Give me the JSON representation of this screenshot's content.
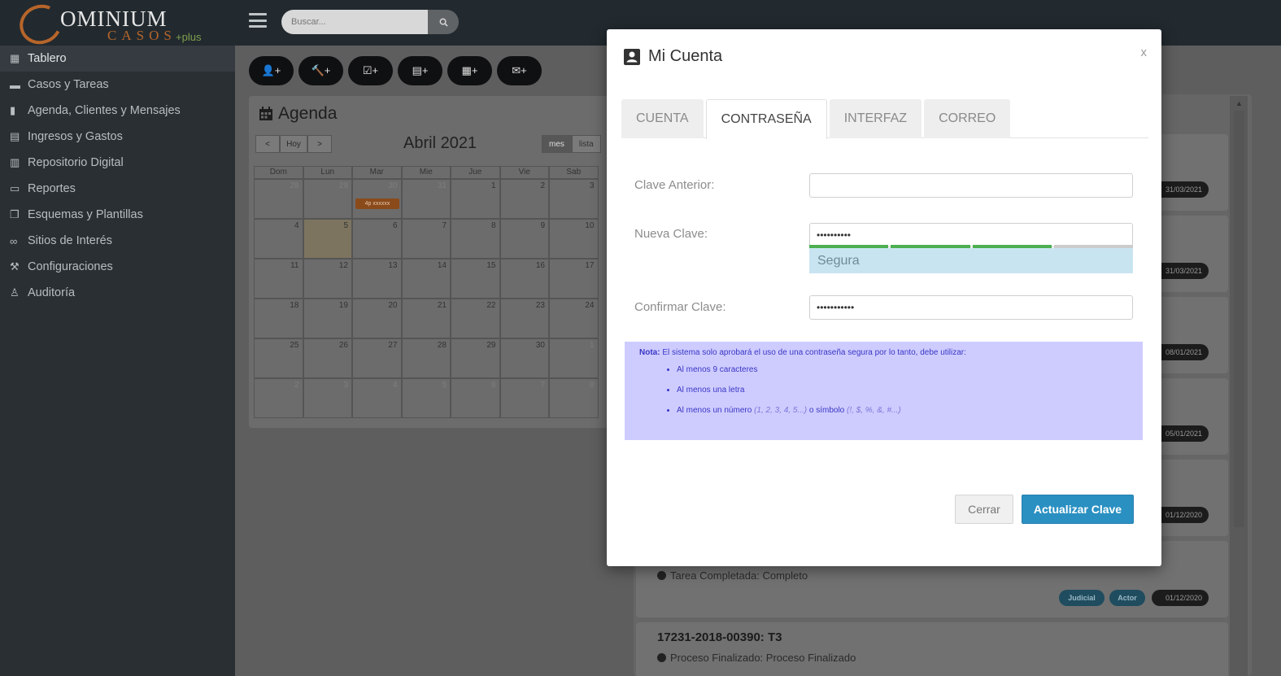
{
  "brand": {
    "main": "OMINIUM",
    "sub": "CASOS",
    "plus": "+plus"
  },
  "search": {
    "placeholder": "Buscar...",
    "button_icon": "search-icon"
  },
  "sidebar": {
    "items": [
      {
        "label": "Tablero",
        "icon": "table-icon",
        "glyph": "▦"
      },
      {
        "label": "Casos y Tareas",
        "icon": "folder-icon",
        "glyph": "▬"
      },
      {
        "label": "Agenda, Clientes y Mensajes",
        "icon": "book-icon",
        "glyph": "▮"
      },
      {
        "label": "Ingresos y Gastos",
        "icon": "file-icon",
        "glyph": "▤"
      },
      {
        "label": "Repositorio Digital",
        "icon": "library-icon",
        "glyph": "▥"
      },
      {
        "label": "Reportes",
        "icon": "report-icon",
        "glyph": "▭"
      },
      {
        "label": "Esquemas y Plantillas",
        "icon": "copy-icon",
        "glyph": "❐"
      },
      {
        "label": "Sitios de Interés",
        "icon": "link-icon",
        "glyph": "∞"
      },
      {
        "label": "Configuraciones",
        "icon": "wrench-icon",
        "glyph": "⚒"
      },
      {
        "label": "Auditoría",
        "icon": "auditor-icon",
        "glyph": "♙"
      }
    ]
  },
  "toolbar": {
    "buttons": [
      {
        "glyph": "👤+",
        "icon": "add-user-icon"
      },
      {
        "glyph": "🔨+",
        "icon": "add-case-icon"
      },
      {
        "glyph": "☑+",
        "icon": "add-task-icon"
      },
      {
        "glyph": "▤+",
        "icon": "add-document-icon"
      },
      {
        "glyph": "▦+",
        "icon": "add-event-icon"
      },
      {
        "glyph": "✉+",
        "icon": "add-message-icon"
      }
    ]
  },
  "agenda": {
    "title": "Agenda",
    "nav": {
      "prev": "<",
      "today": "Hoy",
      "next": ">"
    },
    "month": "Abril 2021",
    "views": {
      "month": "mes",
      "list": "lista"
    },
    "weekdays": [
      "Dom",
      "Lun",
      "Mar",
      "Mie",
      "Jue",
      "Vie",
      "Sab"
    ],
    "weeks": [
      [
        "28",
        "29",
        "30",
        "31",
        "1",
        "2",
        "3"
      ],
      [
        "4",
        "5",
        "6",
        "7",
        "8",
        "9",
        "10"
      ],
      [
        "11",
        "12",
        "13",
        "14",
        "15",
        "16",
        "17"
      ],
      [
        "18",
        "19",
        "20",
        "21",
        "22",
        "23",
        "24"
      ],
      [
        "25",
        "26",
        "27",
        "28",
        "29",
        "30",
        "1"
      ],
      [
        "2",
        "3",
        "4",
        "5",
        "6",
        "7",
        "8"
      ]
    ],
    "event_label": "4p xxxxxx"
  },
  "cases": {
    "dates": [
      "31/03/2021",
      "31/03/2021",
      "08/01/2021",
      "05/01/2021",
      "01/12/2020"
    ],
    "completed_task": {
      "status": "Tarea Completada: Completo",
      "tags": [
        "Judicial",
        "Actor"
      ],
      "date": "01/12/2020"
    },
    "last": {
      "title": "17231-2018-00390: T3",
      "status": "Proceso Finalizado: Proceso Finalizado"
    }
  },
  "modal": {
    "title": "Mi Cuenta",
    "title_icon": "account-card-icon",
    "close": "x",
    "tabs": [
      "CUENTA",
      "CONTRASEÑA",
      "INTERFAZ",
      "CORREO"
    ],
    "active_tab": "CONTRASEÑA",
    "fields": {
      "old_label": "Clave Anterior:",
      "old_value": "",
      "new_label": "Nueva Clave:",
      "new_value": "••••••••••",
      "confirm_label": "Confirmar Clave:",
      "confirm_value": "•••••••••••"
    },
    "strength": {
      "label": "Segura",
      "level": 0.75
    },
    "note": {
      "heading": "Nota:",
      "text": "El sistema solo aprobará el uso de una contraseña segura por lo tanto, debe utilizar:",
      "rules": [
        {
          "text": "Al menos 9 caracteres",
          "hint": ""
        },
        {
          "text": "Al menos una letra",
          "hint": ""
        },
        {
          "text": "Al menos un número",
          "hint": "(1, 2, 3, 4, 5...)",
          "mid": "o símbolo",
          "hint2": "(!, $, %, &, #...)"
        }
      ]
    },
    "buttons": {
      "close": "Cerrar",
      "update": "Actualizar Clave"
    }
  },
  "colors": {
    "primary": "#2a90c2",
    "strength_good": "#4caf50",
    "note_bg": "#ceccff",
    "brand_orange": "#b7652a"
  }
}
